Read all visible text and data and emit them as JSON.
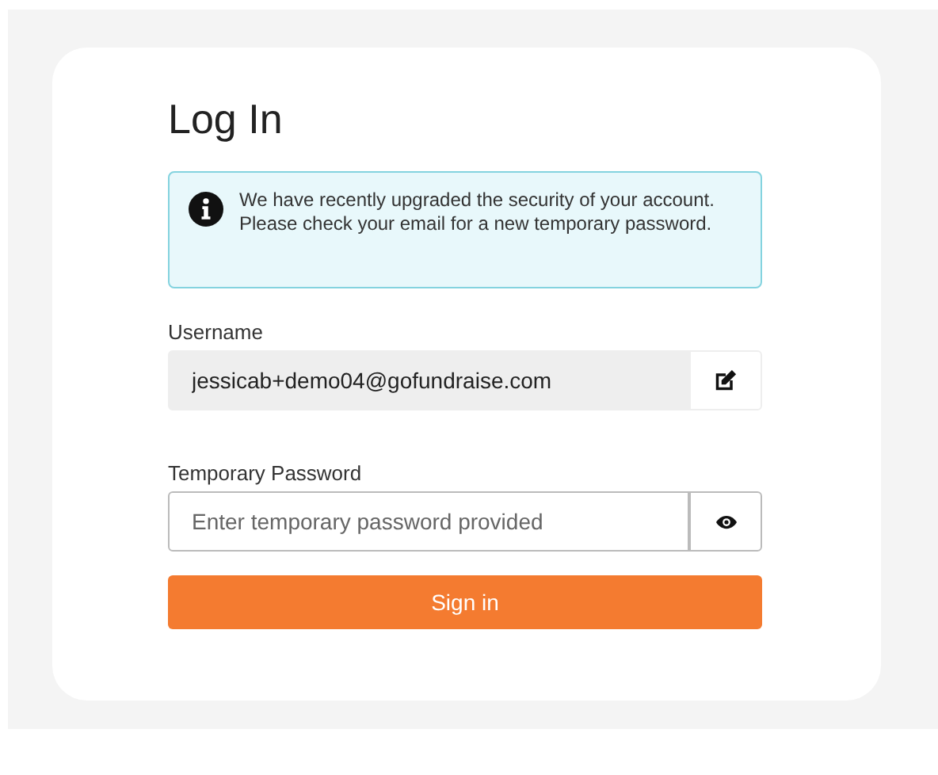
{
  "title": "Log In",
  "alert": {
    "text": "We have recently upgraded the security of your account. Please check your email for a new temporary password."
  },
  "username": {
    "label": "Username",
    "value": "jessicab+demo04@gofundraise.com",
    "disabled": true
  },
  "password": {
    "label": "Temporary Password",
    "placeholder": "Enter temporary password provided"
  },
  "submit": {
    "label": "Sign in"
  }
}
